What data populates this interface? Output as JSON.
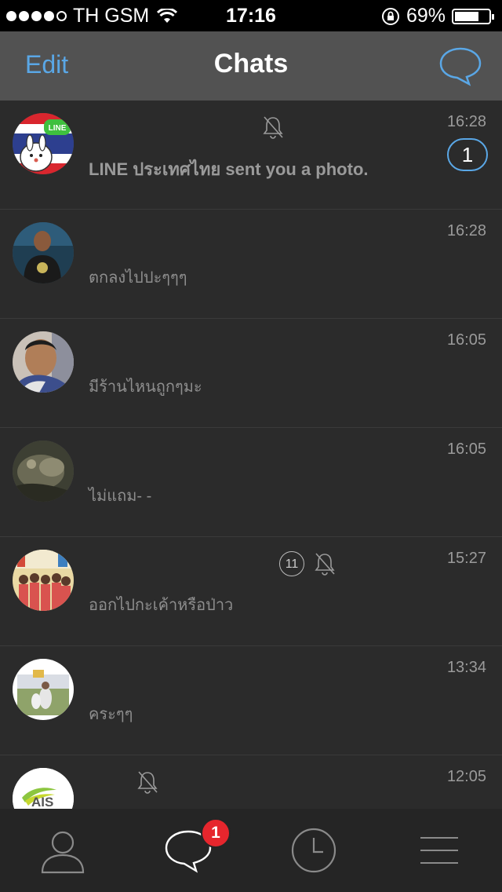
{
  "status_bar": {
    "carrier": "TH GSM",
    "time": "17:16",
    "battery": "69%",
    "signal_bars_filled": 4,
    "battery_level": 0.69
  },
  "nav": {
    "edit": "Edit",
    "title": "Chats",
    "compose_icon": "chat-bubble-icon"
  },
  "chats": [
    {
      "time": "16:28",
      "message": "LINE ประเทศไทย sent you a photo.",
      "muted": true,
      "unread": "1"
    },
    {
      "time": "16:28",
      "message": "ตกลงไปปะๆๆๆ"
    },
    {
      "time": "16:05",
      "message": "มีร้านไหนถูกๆมะ"
    },
    {
      "time": "16:05",
      "message": "ไม่แถม- -"
    },
    {
      "time": "15:27",
      "message": "ออกไปกะเค้าหรือป่าว",
      "member_count": "11",
      "muted": true
    },
    {
      "time": "13:34",
      "message": "คระๆๆ"
    },
    {
      "time": "12:05",
      "message": "",
      "muted": true,
      "avatar_text": "AIS"
    }
  ],
  "tab_bar": {
    "friends_icon": "person-icon",
    "chats_icon": "chat-bubble-icon",
    "chats_badge": "1",
    "timeline_icon": "clock-icon",
    "more_icon": "menu-lines-icon"
  },
  "colors": {
    "accent": "#5aa7e6",
    "badge": "#e6262d",
    "background": "#2b2b2b",
    "nav_bar": "#525252"
  }
}
